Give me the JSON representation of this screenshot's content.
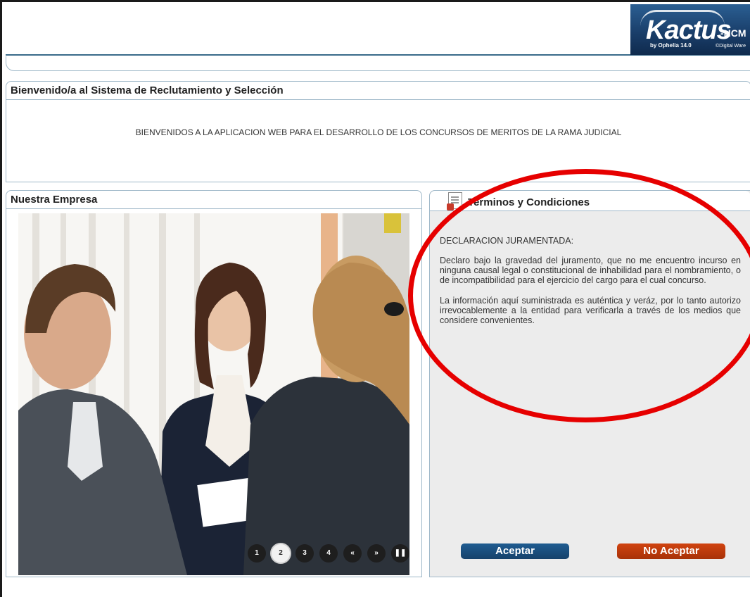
{
  "header": {
    "logo": {
      "main": "Kactus",
      "suffix": "-HCM",
      "by": "by Ophelia 14.0",
      "copyright": "©Digital Ware"
    }
  },
  "welcome": {
    "title": "Bienvenido/a al Sistema de Reclutamiento y Selección",
    "message": "BIENVENIDOS A LA APLICACION WEB PARA EL DESARROLLO DE LOS CONCURSOS DE MERITOS DE LA RAMA JUDICIAL"
  },
  "empresa": {
    "title": "Nuestra Empresa",
    "slider": {
      "buttons": [
        "1",
        "2",
        "3",
        "4",
        "«",
        "»",
        "❚❚"
      ],
      "active_index": 1
    }
  },
  "terminos": {
    "title": "Terminos y Condiciones",
    "heading": "DECLARACION JURAMENTADA:",
    "paragraph1": "Declaro bajo la gravedad del juramento, que no me encuentro incurso en ninguna causal legal o constitucional de inhabilidad para el nombramiento, o de incompatibilidad para el ejercicio del cargo para el cual concurso.",
    "paragraph2": "La información aquí suministrada es auténtica y veráz, por lo tanto autorizo irrevocablemente a la entidad para verificarla a través de los medios que considere convenientes.",
    "accept_label": "Aceptar",
    "reject_label": "No Aceptar"
  },
  "colors": {
    "accept": "#1f5c91",
    "reject": "#d04310",
    "annotation": "#e60000",
    "panel_border": "#9fb8c9"
  }
}
